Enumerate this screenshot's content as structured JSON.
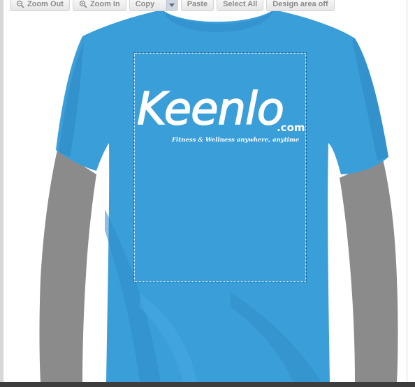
{
  "toolbar": {
    "zoom_out_label": "Zoom Out",
    "zoom_in_label": "Zoom In",
    "copy_label": "Copy",
    "paste_label": "Paste",
    "select_all_label": "Select All",
    "design_area_label": "Design area off"
  },
  "design": {
    "logo_word": "Keenlo",
    "logo_domain": ".com",
    "tagline": "Fitness & Wellness anywhere, anytime"
  },
  "colors": {
    "shirt": "#3a9ed9",
    "shirt_shadow": "#2f86bd",
    "mannequin": "#8a8a8a",
    "design_text": "#ffffff"
  }
}
